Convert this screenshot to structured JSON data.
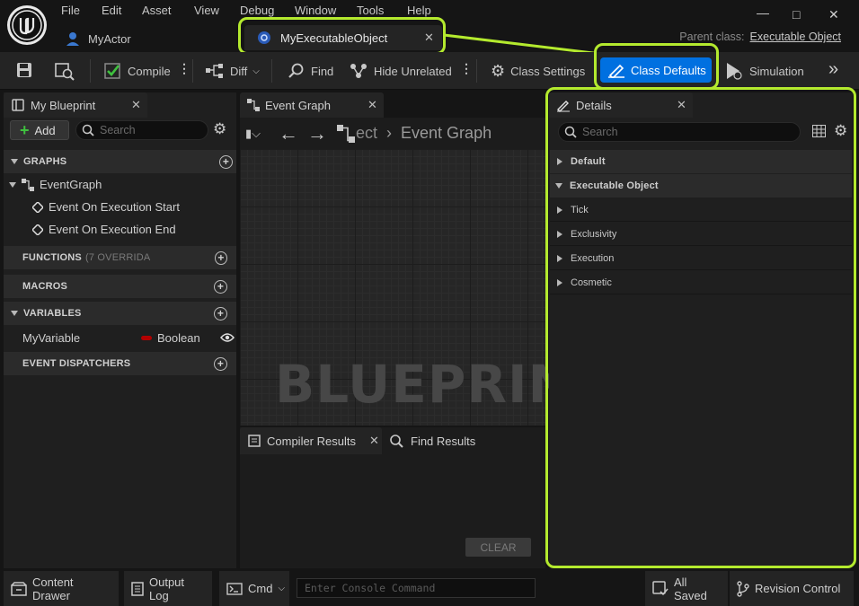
{
  "menu": [
    "File",
    "Edit",
    "Asset",
    "View",
    "Debug",
    "Window",
    "Tools",
    "Help"
  ],
  "tabs": {
    "actor": "MyActor",
    "exec": "MyExecutableObject"
  },
  "parent_class": {
    "label": "Parent class:",
    "value": "Executable Object"
  },
  "toolbar": {
    "compile": "Compile",
    "diff": "Diff",
    "find": "Find",
    "hide_unrelated": "Hide Unrelated",
    "class_settings": "Class Settings",
    "class_defaults": "Class Defaults",
    "simulation": "Simulation"
  },
  "my_blueprint": {
    "tab": "My Blueprint",
    "add": "Add",
    "search_placeholder": "Search",
    "graphs": "GRAPHS",
    "event_graph": "EventGraph",
    "events": [
      "Event On Execution Start",
      "Event On Execution End"
    ],
    "functions": "FUNCTIONS",
    "functions_note": "(7 OVERRIDA",
    "macros": "MACROS",
    "variables": "VARIABLES",
    "variable_name": "MyVariable",
    "variable_type": "Boolean",
    "variable_color": "#b30000",
    "event_dispatchers": "EVENT DISPATCHERS"
  },
  "graph": {
    "tab": "Event Graph",
    "breadcrumb_prev": "ect",
    "breadcrumb": "Event Graph",
    "watermark": "BLUEPRINT"
  },
  "compiler": {
    "tab_results": "Compiler Results",
    "tab_find": "Find Results",
    "clear": "CLEAR"
  },
  "details": {
    "tab": "Details",
    "search_placeholder": "Search",
    "sections": [
      "Default",
      "Executable Object"
    ],
    "rows": [
      "Tick",
      "Exclusivity",
      "Execution",
      "Cosmetic"
    ]
  },
  "status": {
    "content_drawer": "Content Drawer",
    "output_log": "Output Log",
    "cmd": "Cmd",
    "console_placeholder": "Enter Console Command",
    "saved": "All Saved",
    "revision": "Revision Control"
  },
  "colors": {
    "accent": "#0070e0",
    "highlight": "#b4ea2e"
  }
}
